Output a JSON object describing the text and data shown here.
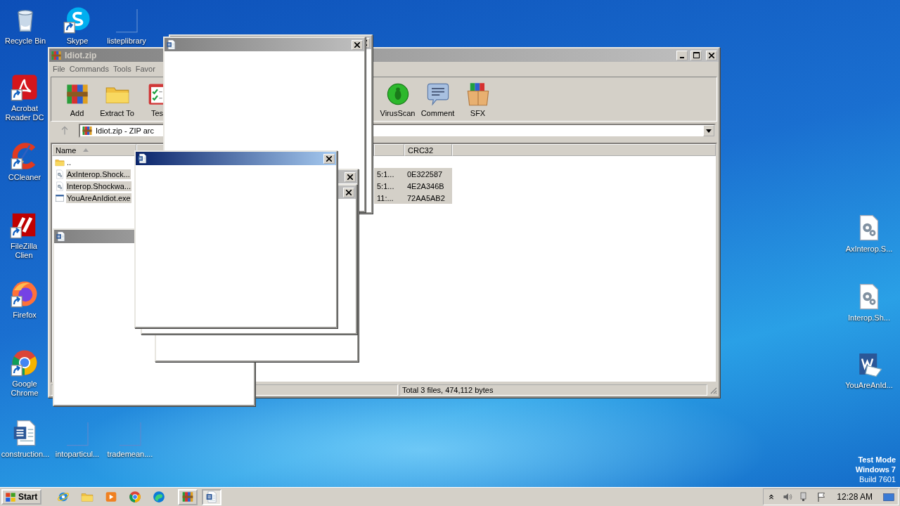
{
  "desktop_icons": [
    {
      "label": "Recycle Bin",
      "kind": "recycle",
      "shortcut": false
    },
    {
      "label": "Skype",
      "kind": "skype",
      "shortcut": true
    },
    {
      "label": "listeplibrary",
      "kind": "blank",
      "shortcut": false
    },
    {
      "label": "Acrobat Reader DC",
      "kind": "acrobat",
      "shortcut": true
    },
    {
      "label": "CCleaner",
      "kind": "ccleaner",
      "shortcut": true
    },
    {
      "label": "FileZilla Clien",
      "kind": "filezilla",
      "shortcut": true
    },
    {
      "label": "Firefox",
      "kind": "firefox",
      "shortcut": true
    },
    {
      "label": "Google Chrome",
      "kind": "chrome",
      "shortcut": true
    },
    {
      "label": "construction...",
      "kind": "worddoc",
      "shortcut": false
    },
    {
      "label": "intoparticul...",
      "kind": "blank",
      "shortcut": false
    },
    {
      "label": "trademean....",
      "kind": "blank",
      "shortcut": false
    },
    {
      "label": "AxInterop.S...",
      "kind": "config",
      "shortcut": false
    },
    {
      "label": "Interop.Sh...",
      "kind": "config",
      "shortcut": false
    },
    {
      "label": "YouAreAnId...",
      "kind": "word",
      "shortcut": false
    }
  ],
  "archive_window": {
    "title": "Idiot.zip",
    "active": false,
    "menu": [
      "File",
      "Commands",
      "Tools",
      "Favor"
    ],
    "toolbar": [
      {
        "label": "Add",
        "kind": "archive"
      },
      {
        "label": "Extract To",
        "kind": "folder"
      },
      {
        "label": "Tes",
        "kind": "checklist"
      },
      {
        "label": "VirusScan",
        "kind": "bug"
      },
      {
        "label": "Comment",
        "kind": "comment"
      },
      {
        "label": "SFX",
        "kind": "box"
      }
    ],
    "address": "Idiot.zip - ZIP arc",
    "columns": [
      "Name",
      "CRC32"
    ],
    "files": [
      {
        "name": "..",
        "kind": "folder",
        "selected": false
      },
      {
        "name": "AxInterop.Shock...",
        "kind": "config",
        "modified": "5:1...",
        "crc": "0E322587",
        "selected": true
      },
      {
        "name": "Interop.Shockwa...",
        "kind": "config",
        "modified": "5:1...",
        "crc": "4E2A346B",
        "selected": true
      },
      {
        "name": "YouAreAnIdiot.exe",
        "kind": "program",
        "modified": "11:...",
        "crc": "72AA5AB2",
        "selected": true
      }
    ],
    "status": "Total 3 files, 474,112 bytes"
  },
  "popups": [
    {
      "active": false
    },
    {
      "active": false
    },
    {
      "active": false
    },
    {
      "active": false
    },
    {
      "active": false
    },
    {
      "active": true
    }
  ],
  "watermark_text": [
    "Test Mode",
    "Windows 7",
    "Build 7601"
  ],
  "taskbar": {
    "start": "Start",
    "quick_launch": [
      {
        "kind": "ie"
      },
      {
        "kind": "folder"
      },
      {
        "kind": "media"
      },
      {
        "kind": "chrome"
      },
      {
        "kind": "edge"
      }
    ],
    "tasks": [
      {
        "kind": "archive",
        "selected": false
      },
      {
        "kind": "worddoc",
        "selected": true
      }
    ],
    "clock": "12:28 AM"
  }
}
